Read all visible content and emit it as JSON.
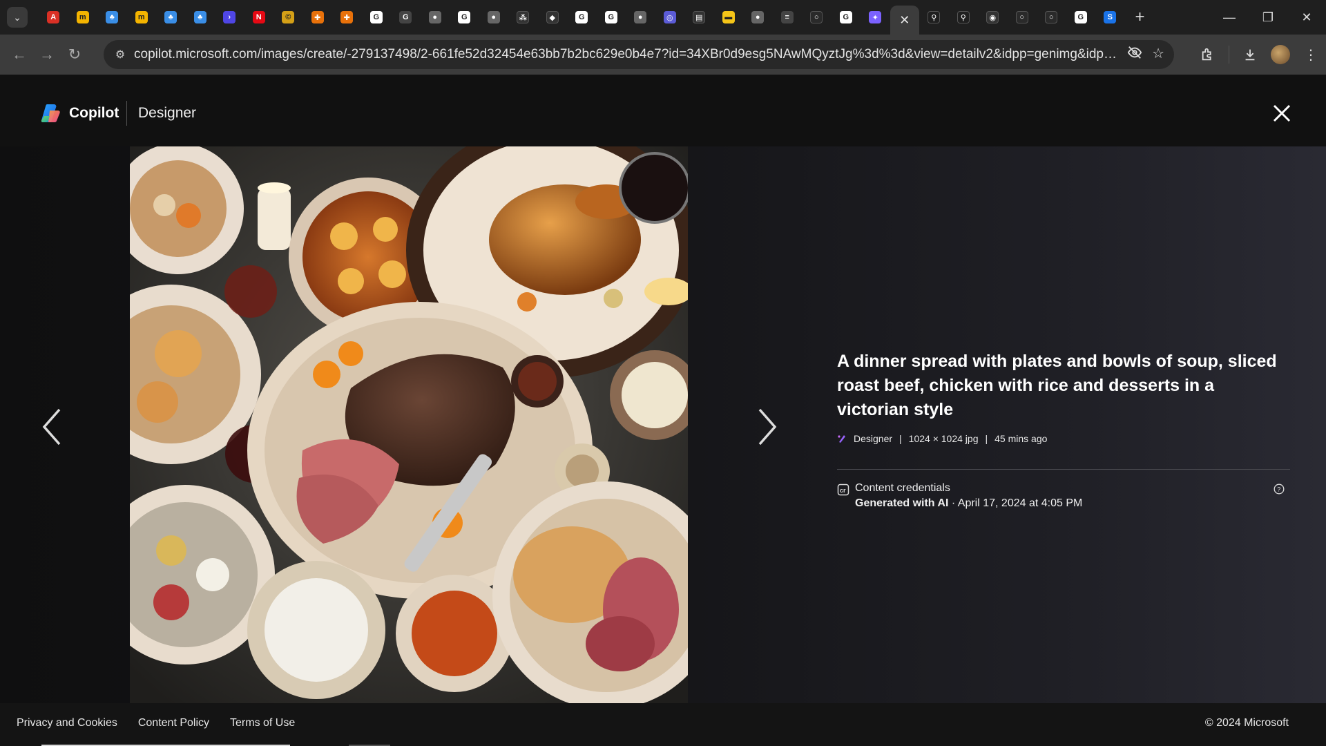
{
  "browser": {
    "tabs": [
      {
        "icon": "chrome-icon",
        "color": "#d93025",
        "glyph": "A"
      },
      {
        "icon": "monday-icon",
        "color": "#f4b400",
        "glyph": "m"
      },
      {
        "icon": "plant-icon",
        "color": "#3a8ee6",
        "glyph": "♣"
      },
      {
        "icon": "monday-icon",
        "color": "#f4b400",
        "glyph": "m"
      },
      {
        "icon": "plant-icon",
        "color": "#3a8ee6",
        "glyph": "♣"
      },
      {
        "icon": "plant-icon",
        "color": "#3a8ee6",
        "glyph": "♣"
      },
      {
        "icon": "terminal-icon",
        "color": "#4f46e5",
        "glyph": "›"
      },
      {
        "icon": "netflix-icon",
        "color": "#e50914",
        "glyph": "N"
      },
      {
        "icon": "coin-icon",
        "color": "#d4a017",
        "glyph": "©"
      },
      {
        "icon": "shield-icon",
        "color": "#e8710a",
        "glyph": "✚"
      },
      {
        "icon": "shield-icon",
        "color": "#e8710a",
        "glyph": "✚"
      },
      {
        "icon": "google-icon",
        "color": "#ffffff",
        "glyph": "G"
      },
      {
        "icon": "google-outline-icon",
        "color": "#444444",
        "glyph": "G"
      },
      {
        "icon": "globe-icon",
        "color": "#666666",
        "glyph": "●"
      },
      {
        "icon": "google-icon",
        "color": "#ffffff",
        "glyph": "G"
      },
      {
        "icon": "globe-icon",
        "color": "#666666",
        "glyph": "●"
      },
      {
        "icon": "graph-icon",
        "color": "#333333",
        "glyph": "⁂"
      },
      {
        "icon": "puzzle-icon",
        "color": "#333333",
        "glyph": "◆"
      },
      {
        "icon": "google-icon",
        "color": "#ffffff",
        "glyph": "G"
      },
      {
        "icon": "google-icon",
        "color": "#ffffff",
        "glyph": "G"
      },
      {
        "icon": "globe-icon",
        "color": "#666666",
        "glyph": "●"
      },
      {
        "icon": "copilot-tab-icon",
        "color": "#5b5bd6",
        "glyph": "◎"
      },
      {
        "icon": "document-icon",
        "color": "#333333",
        "glyph": "▤"
      },
      {
        "icon": "imdb-icon",
        "color": "#f5c518",
        "glyph": "▬"
      },
      {
        "icon": "globe-icon",
        "color": "#666666",
        "glyph": "●"
      },
      {
        "icon": "rainbow-icon",
        "color": "#444444",
        "glyph": "≡"
      },
      {
        "icon": "circle-icon",
        "color": "#2a2a2a",
        "glyph": "○"
      },
      {
        "icon": "google-icon",
        "color": "#ffffff",
        "glyph": "G"
      },
      {
        "icon": "copilot-tab-icon",
        "color": "#7b61ff",
        "glyph": "✦"
      },
      {
        "icon": "close-icon",
        "color": "#3c3c3c",
        "glyph": "✕",
        "active": true
      },
      {
        "icon": "search-icon",
        "color": "#1f1f1f",
        "glyph": "⚲"
      },
      {
        "icon": "search-icon",
        "color": "#1f1f1f",
        "glyph": "⚲"
      },
      {
        "icon": "camera-icon",
        "color": "#333333",
        "glyph": "◉"
      },
      {
        "icon": "circle-icon",
        "color": "#2a2a2a",
        "glyph": "○"
      },
      {
        "icon": "circle-icon",
        "color": "#2a2a2a",
        "glyph": "○"
      },
      {
        "icon": "google-icon",
        "color": "#ffffff",
        "glyph": "G"
      },
      {
        "icon": "src-icon",
        "color": "#1a73e8",
        "glyph": "S"
      }
    ],
    "url": "copilot.microsoft.com/images/create/-279137498/2-661fe52d32454e63bb7b2bc629e0b4e7?id=34XBr0d9esg5NAwMQyztJg%3d%3d&view=detailv2&idpp=genimg&idpclose=1&ge..."
  },
  "header": {
    "brand": "Copilot",
    "product": "Designer"
  },
  "image": {
    "alt": "",
    "palette": {
      "bg": "#2a2a2d",
      "plate": "#e8dccd",
      "meat": "#6b3a2a",
      "soup": "#b5561e",
      "chicken": "#c07a2e"
    }
  },
  "details": {
    "title": "A dinner spread with plates and bowls of soup, sliced roast beef, chicken with rice and desserts in a victorian style",
    "source": "Designer",
    "size": "1024 × 1024 jpg",
    "age": "45 mins ago",
    "credentials_label": "Content credentials",
    "generated": "Generated with AI",
    "date": " · April 17, 2024 at 4:05 PM"
  },
  "footer": {
    "links": [
      "Privacy and Cookies",
      "Content Policy",
      "Terms of Use"
    ],
    "copyright": "© 2024 Microsoft"
  }
}
